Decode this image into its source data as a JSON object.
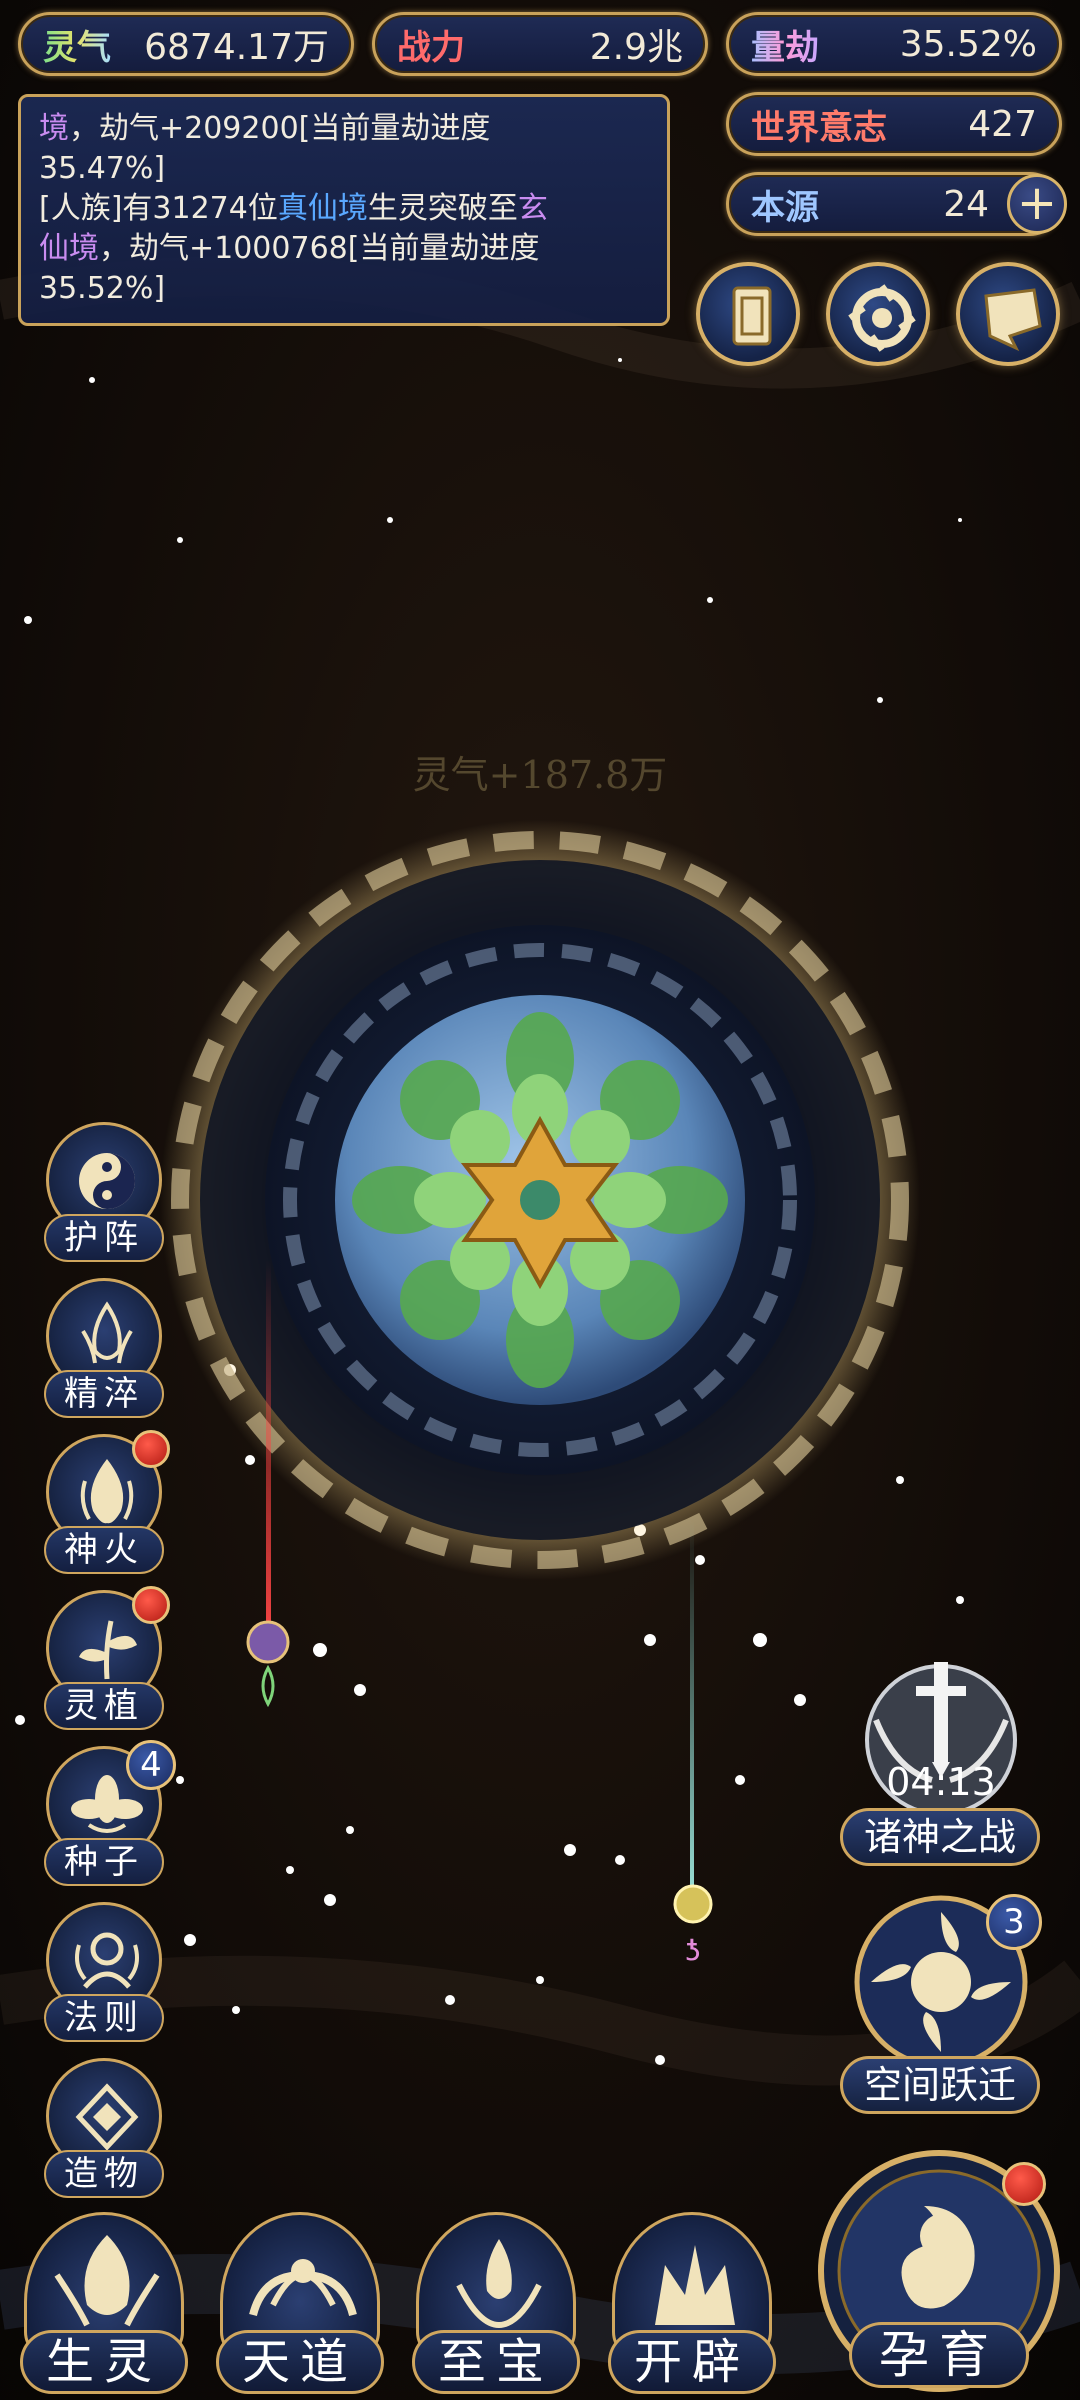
{
  "top_bar": {
    "linqi": {
      "label": "灵气",
      "value": "6874.17万"
    },
    "zhanli": {
      "label": "战力",
      "value": "2.9兆"
    },
    "liangjie": {
      "label": "量劫",
      "value": "35.52%"
    },
    "shijie_yizhi": {
      "label": "世界意志",
      "value": "427"
    },
    "benyuan": {
      "label": "本源",
      "value": "24",
      "add": "+"
    }
  },
  "log": {
    "line1_a": "境",
    "line1_b": "，劫气+209200[当前量劫进度",
    "line2": "35.47%]",
    "line3_a": "[人族]有31274位",
    "line3_b": "真仙境",
    "line3_c": "生灵突破至",
    "line3_d": "玄",
    "line4_a": "仙境",
    "line4_b": "，劫气+1000768[当前量劫进度",
    "line5": "35.52%]"
  },
  "floating_gain": "灵气+187.8万",
  "side_menu": [
    {
      "label": "护阵",
      "icon": "yin-yang-icon"
    },
    {
      "label": "精淬",
      "icon": "flame-lotus-icon"
    },
    {
      "label": "神火",
      "icon": "fire-icon",
      "red_dot": true
    },
    {
      "label": "灵植",
      "icon": "plant-icon",
      "red_dot": true
    },
    {
      "label": "种子",
      "icon": "seed-lotus-icon",
      "badge": "4"
    },
    {
      "label": "法则",
      "icon": "rune-icon"
    },
    {
      "label": "造物",
      "icon": "diamond-rune-icon"
    }
  ],
  "events": {
    "gods_war": {
      "label": "诸神之战",
      "timer": "04:13"
    },
    "space_jump": {
      "label": "空间跃迁",
      "badge": "3"
    }
  },
  "bottom_nav": [
    {
      "label": "生灵"
    },
    {
      "label": "天道"
    },
    {
      "label": "至宝"
    },
    {
      "label": "开辟"
    }
  ],
  "main_action": {
    "label": "孕育",
    "red_dot": true
  },
  "colors": {
    "gold": "#cfa65e",
    "panel_blue": "#1c2a56",
    "red_dot": "#d12b1f"
  }
}
